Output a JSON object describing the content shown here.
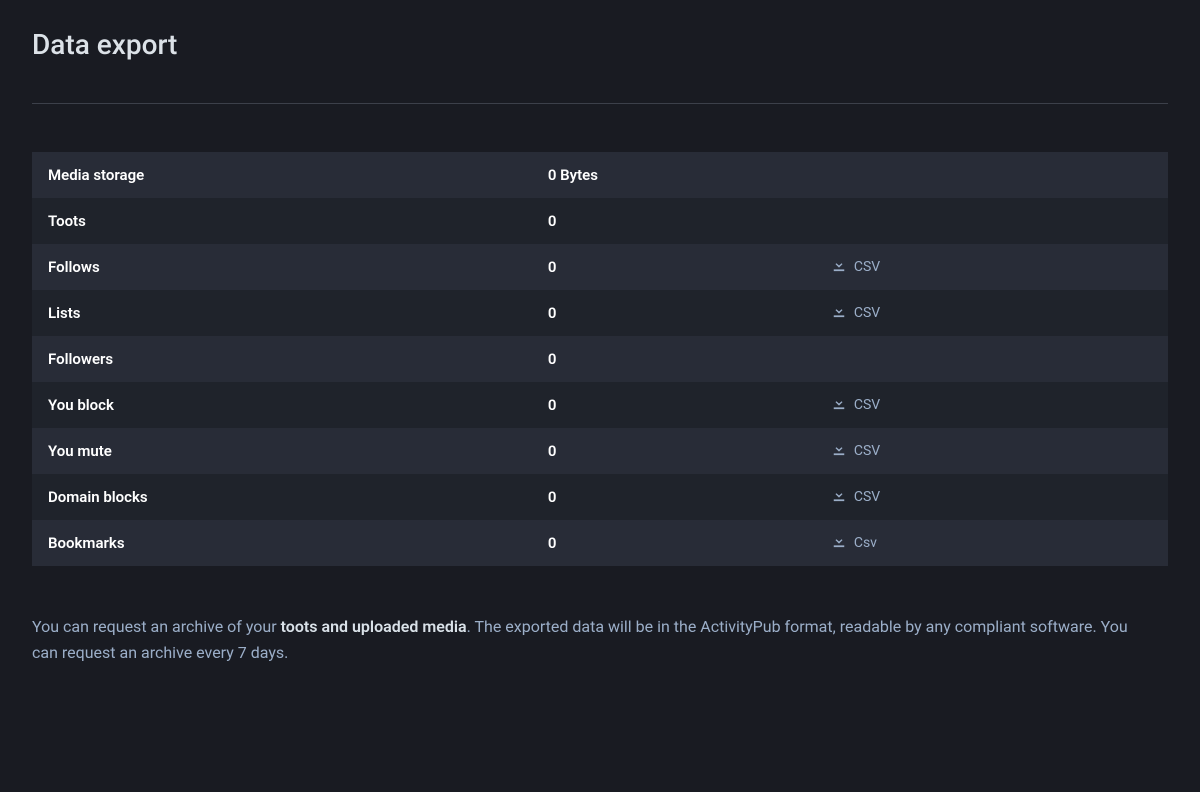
{
  "page": {
    "title": "Data export"
  },
  "rows": [
    {
      "label": "Media storage",
      "value": "0 Bytes",
      "csv": false,
      "csv_label": ""
    },
    {
      "label": "Toots",
      "value": "0",
      "csv": false,
      "csv_label": ""
    },
    {
      "label": "Follows",
      "value": "0",
      "csv": true,
      "csv_label": "CSV"
    },
    {
      "label": "Lists",
      "value": "0",
      "csv": true,
      "csv_label": "CSV"
    },
    {
      "label": "Followers",
      "value": "0",
      "csv": false,
      "csv_label": ""
    },
    {
      "label": "You block",
      "value": "0",
      "csv": true,
      "csv_label": "CSV"
    },
    {
      "label": "You mute",
      "value": "0",
      "csv": true,
      "csv_label": "CSV"
    },
    {
      "label": "Domain blocks",
      "value": "0",
      "csv": true,
      "csv_label": "CSV"
    },
    {
      "label": "Bookmarks",
      "value": "0",
      "csv": true,
      "csv_label": "Csv"
    }
  ],
  "info": {
    "prefix": "You can request an archive of your ",
    "bold": "toots and uploaded media",
    "suffix": ". The exported data will be in the ActivityPub format, readable by any compliant software. You can request an archive every 7 days."
  }
}
